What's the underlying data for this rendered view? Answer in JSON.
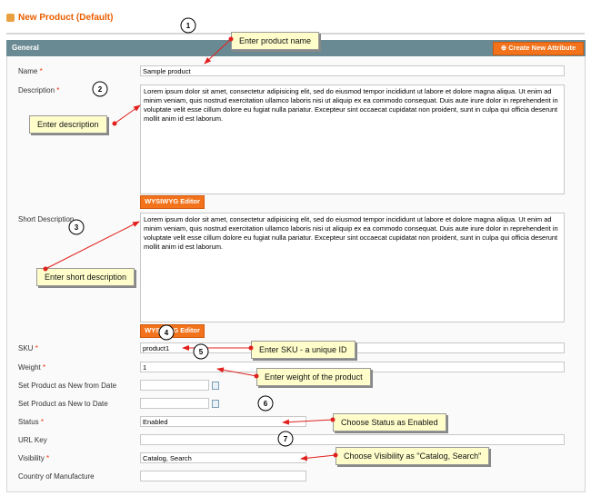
{
  "page_title": "New Product (Default)",
  "section": {
    "title": "General",
    "create_attribute_label": "Create New Attribute"
  },
  "fields": {
    "name": {
      "label": "Name",
      "value": "Sample product"
    },
    "description": {
      "label": "Description",
      "value": "Lorem ipsum dolor sit amet, consectetur adipisicing elit, sed do eiusmod tempor incididunt ut labore et dolore magna aliqua. Ut enim ad minim veniam, quis nostrud exercitation ullamco laboris nisi ut aliquip ex ea commodo consequat. Duis aute irure dolor in reprehenderit in voluptate velit esse cillum dolore eu fugiat nulla pariatur. Excepteur sint occaecat cupidatat non proident, sunt in culpa qui officia deserunt mollit anim id est laborum."
    },
    "short_description": {
      "label": "Short Description",
      "value": "Lorem ipsum dolor sit amet, consectetur adipisicing elit, sed do eiusmod tempor incididunt ut labore et dolore magna aliqua. Ut enim ad minim veniam, quis nostrud exercitation ullamco laboris nisi ut aliquip ex ea commodo consequat. Duis aute irure dolor in reprehenderit in voluptate velit esse cillum dolore eu fugiat nulla pariatur. Excepteur sint occaecat cupidatat non proident, sunt in culpa qui officia deserunt mollit anim id est laborum."
    },
    "wysiwyg_label": "WYSIWYG Editor",
    "sku": {
      "label": "SKU",
      "value": "product1"
    },
    "weight": {
      "label": "Weight",
      "value": "1"
    },
    "new_from": {
      "label": "Set Product as New from Date",
      "value": ""
    },
    "new_to": {
      "label": "Set Product as New to Date",
      "value": ""
    },
    "status": {
      "label": "Status",
      "value": "Enabled"
    },
    "url_key": {
      "label": "URL Key",
      "value": ""
    },
    "visibility": {
      "label": "Visibility",
      "value": "Catalog, Search"
    },
    "country": {
      "label": "Country of Manufacture",
      "value": ""
    },
    "required_mark": "*"
  },
  "callouts": {
    "name": "Enter product name",
    "description": "Enter description",
    "short_description": "Enter short description",
    "sku": "Enter SKU - a unique ID",
    "weight": "Enter weight of the product",
    "status": "Choose Status as Enabled",
    "visibility": "Choose Visibility as \"Catalog, Search\""
  },
  "steps": [
    "1",
    "2",
    "3",
    "4",
    "5",
    "6",
    "7"
  ],
  "colors": {
    "accent": "#eb5e00",
    "header": "#6a8a93",
    "button": "#f2731b",
    "callout": "#fffecb",
    "arrow": "#e0201c"
  }
}
